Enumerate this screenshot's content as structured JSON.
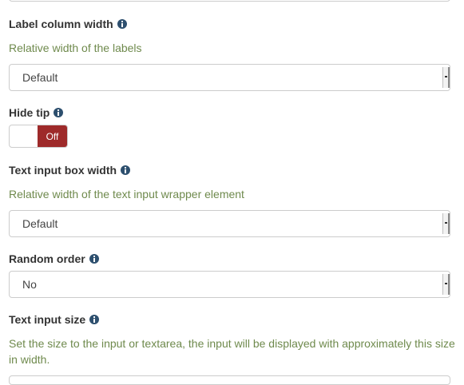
{
  "fields": {
    "label_column_width": {
      "label": "Label column width",
      "description": "Relative width of the labels",
      "value": "Default"
    },
    "hide_tip": {
      "label": "Hide tip",
      "toggle_state": "Off"
    },
    "text_input_box_width": {
      "label": "Text input box width",
      "description": "Relative width of the text input wrapper element",
      "value": "Default"
    },
    "random_order": {
      "label": "Random order",
      "value": "No"
    },
    "text_input_size": {
      "label": "Text input size",
      "description": "Set the size to the input or textarea, the input will be displayed with approximately this size in width."
    }
  },
  "icons": {
    "info": "info-circle-icon",
    "select_arrow": "dropdown-arrow-icon"
  },
  "colors": {
    "toggle_off": "#9e2a2a",
    "description_text": "#6f8a4d",
    "info_icon": "#2d4f6e"
  }
}
